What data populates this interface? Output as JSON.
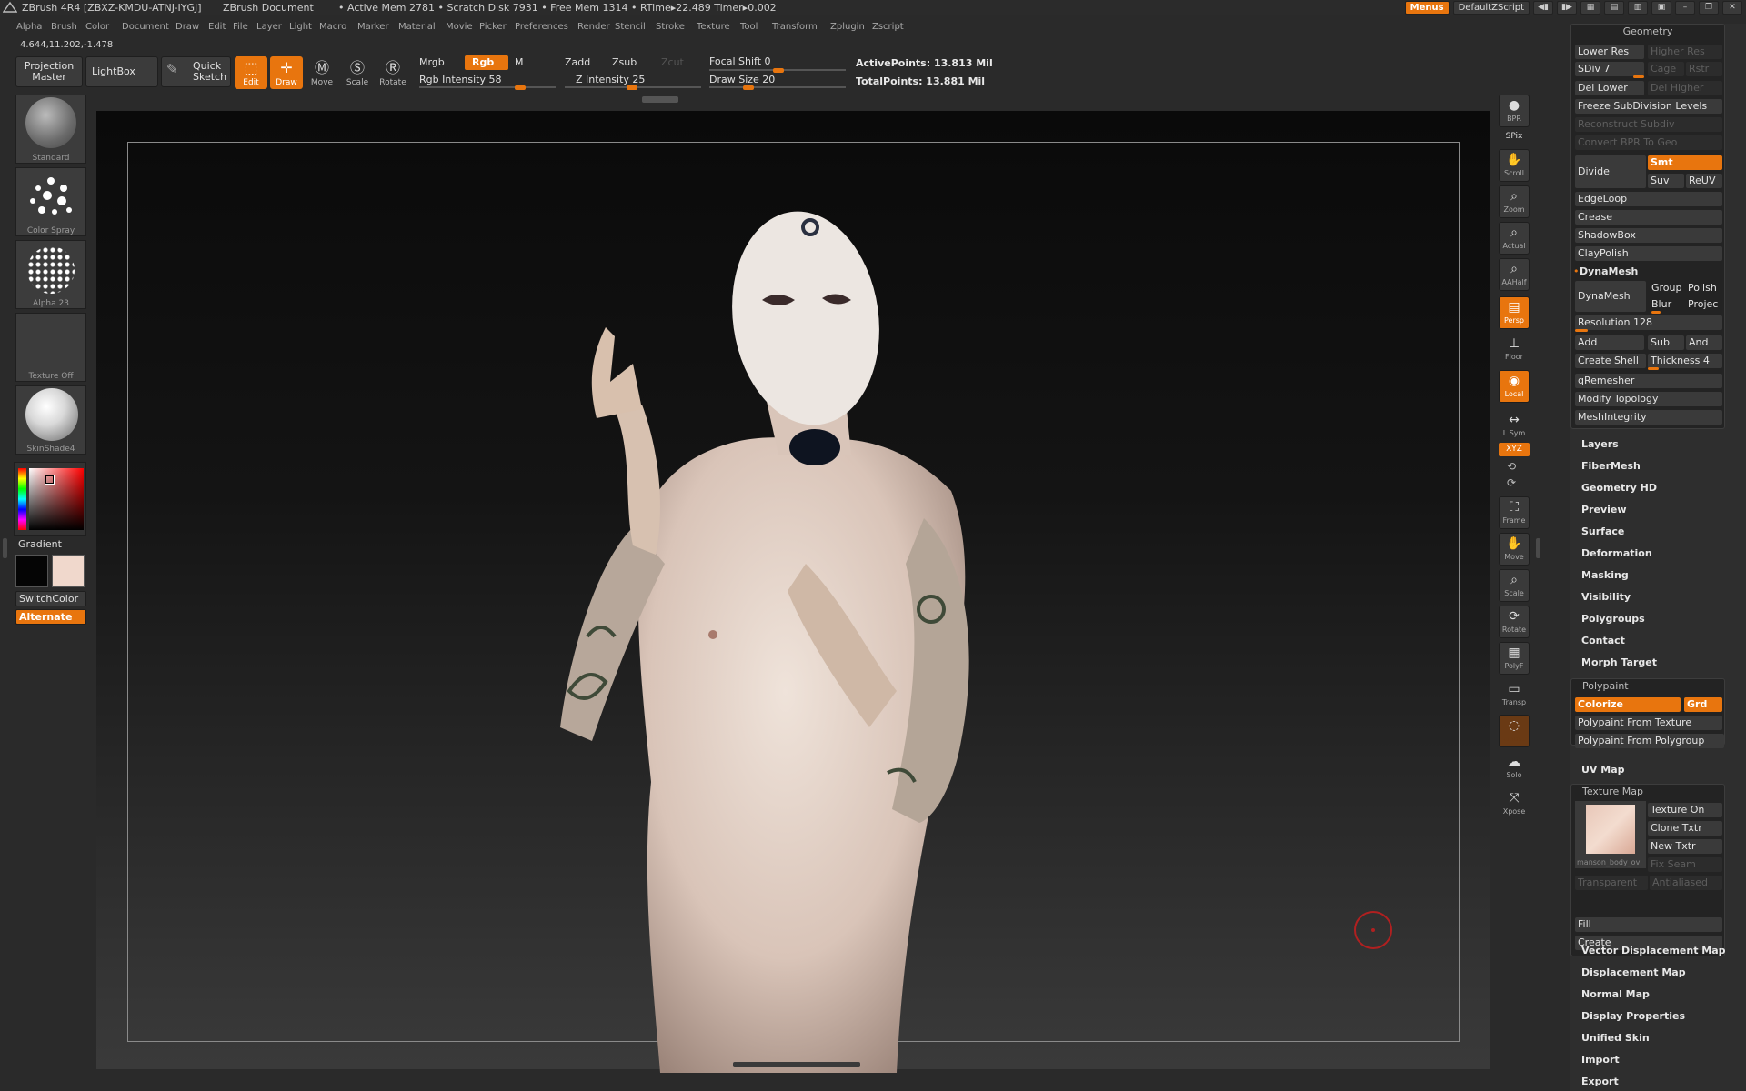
{
  "titlebar": {
    "app_title": "ZBrush 4R4 [ZBXZ-KMDU-ATNJ-IYGJ]",
    "document": "ZBrush Document",
    "status": "• Active Mem 2781 • Scratch Disk 7931 • Free Mem 1314 • RTime▸22.489 Timer▸0.002",
    "menus_button": "Menus",
    "script_button": "DefaultZScript"
  },
  "menubar": [
    "Alpha",
    "Brush",
    "Color",
    "Document",
    "Draw",
    "Edit",
    "File",
    "Layer",
    "Light",
    "Macro",
    "Marker",
    "Material",
    "Movie",
    "Picker",
    "Preferences",
    "Render",
    "Stencil",
    "Stroke",
    "Texture",
    "Tool",
    "Transform",
    "Zplugin",
    "Zscript"
  ],
  "coords": "4.644,11.202,-1.478",
  "toolbar": {
    "projection_master": "Projection Master",
    "lightbox": "LightBox",
    "quick_sketch": "Quick Sketch",
    "edit": "Edit",
    "draw": "Draw",
    "move": "Move",
    "scale": "Scale",
    "rotate": "Rotate",
    "mrgb": "Mrgb",
    "rgb": "Rgb",
    "m": "M",
    "rgb_intensity": "Rgb Intensity 58",
    "zadd": "Zadd",
    "zsub": "Zsub",
    "zcut": "Zcut",
    "z_intensity": "Z Intensity 25",
    "focal_shift": "Focal Shift 0",
    "draw_size": "Draw Size 20",
    "active_points": "ActivePoints: 13.813 Mil",
    "total_points": "TotalPoints: 13.881 Mil"
  },
  "left_shelf": {
    "brush": "Standard",
    "stroke": "Color Spray",
    "alpha": "Alpha 23",
    "texture": "Texture Off",
    "material": "SkinShade4",
    "gradient": "Gradient",
    "switch_color": "SwitchColor",
    "alternate": "Alternate",
    "main_color": "#050505",
    "secondary_color": "#f0d8cc"
  },
  "right_shelf": [
    "BPR",
    "SPix",
    "Scroll",
    "Zoom",
    "Actual",
    "AAHalf",
    "Persp",
    "Floor",
    "Local",
    "L.Sym",
    "XYZ",
    "Frame",
    "Move",
    "Scale",
    "Rotate",
    "PolyF",
    "Transp",
    "Ghost",
    "Solo",
    "Xpose"
  ],
  "geometry": {
    "header": "Geometry",
    "lower_res": "Lower Res",
    "higher_res": "Higher Res",
    "sdiv": "SDiv 7",
    "cage": "Cage",
    "rstr": "Rstr",
    "del_lower": "Del Lower",
    "del_higher": "Del Higher",
    "freeze": "Freeze SubDivision Levels",
    "reconstruct": "Reconstruct Subdiv",
    "convert_bpr": "Convert BPR To Geo",
    "divide": "Divide",
    "smt": "Smt",
    "suv": "Suv",
    "reuv": "ReUV",
    "edgeloop": "EdgeLoop",
    "crease": "Crease",
    "shadowbox": "ShadowBox",
    "claypolish": "ClayPolish",
    "dynamesh_header": "DynaMesh",
    "dynamesh": "DynaMesh",
    "group": "Group",
    "polish": "Polish",
    "blur": "Blur",
    "project": "Projec",
    "resolution": "Resolution 128",
    "add": "Add",
    "sub": "Sub",
    "and": "And",
    "create_shell": "Create Shell",
    "thickness": "Thickness 4",
    "qremesher": "qRemesher",
    "modify_topology": "Modify Topology",
    "meshintegrity": "MeshIntegrity"
  },
  "sections_a": [
    "Layers",
    "FiberMesh",
    "Geometry HD",
    "Preview",
    "Surface",
    "Deformation",
    "Masking",
    "Visibility",
    "Polygroups",
    "Contact",
    "Morph Target"
  ],
  "polypaint": {
    "header": "Polypaint",
    "colorize": "Colorize",
    "grd": "Grd",
    "from_texture": "Polypaint From Texture",
    "from_polygroup": "Polypaint From Polygroup"
  },
  "uv_map": "UV Map",
  "texture_map": {
    "header": "Texture Map",
    "texture_on": "Texture On",
    "clone_txtr": "Clone Txtr",
    "new_txtr": "New Txtr",
    "fix_seam": "Fix Seam",
    "thumb_caption": "manson_body_ov",
    "transparent": "Transparent",
    "antialiased": "Antialiased",
    "fill": "Fill",
    "create": "Create"
  },
  "sections_b": [
    "Vector Displacement Map",
    "Displacement Map",
    "Normal Map",
    "Display Properties",
    "Unified Skin",
    "Import",
    "Export"
  ]
}
